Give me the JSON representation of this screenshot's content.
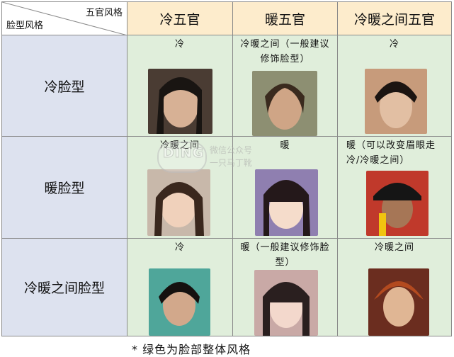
{
  "corner": {
    "top_label": "五官风格",
    "bottom_label": "脸型风格"
  },
  "columns": [
    "冷五官",
    "暖五官",
    "冷暖之间五官"
  ],
  "rows": [
    "冷脸型",
    "暖脸型",
    "冷暖之间脸型"
  ],
  "cells": [
    [
      "冷",
      "冷暖之间（一般建议修饰脸型）",
      "冷"
    ],
    [
      "冷暖之间",
      "暖",
      "暖（可以改变眉眼走冷/冷暖之间）"
    ],
    [
      "冷",
      "暖（一般建议修饰脸型）",
      "冷暖之间"
    ]
  ],
  "watermark": {
    "logo": "DING",
    "line1": "微信公众号",
    "line2": "一只马丁靴"
  },
  "footnote": "* 绿色为脸部整体风格",
  "colors": {
    "header": "#fdeccc",
    "row_header": "#dde2ef",
    "body": "#e0eedb",
    "border": "#8a8a8a"
  },
  "photo_icon": "portrait-photo"
}
